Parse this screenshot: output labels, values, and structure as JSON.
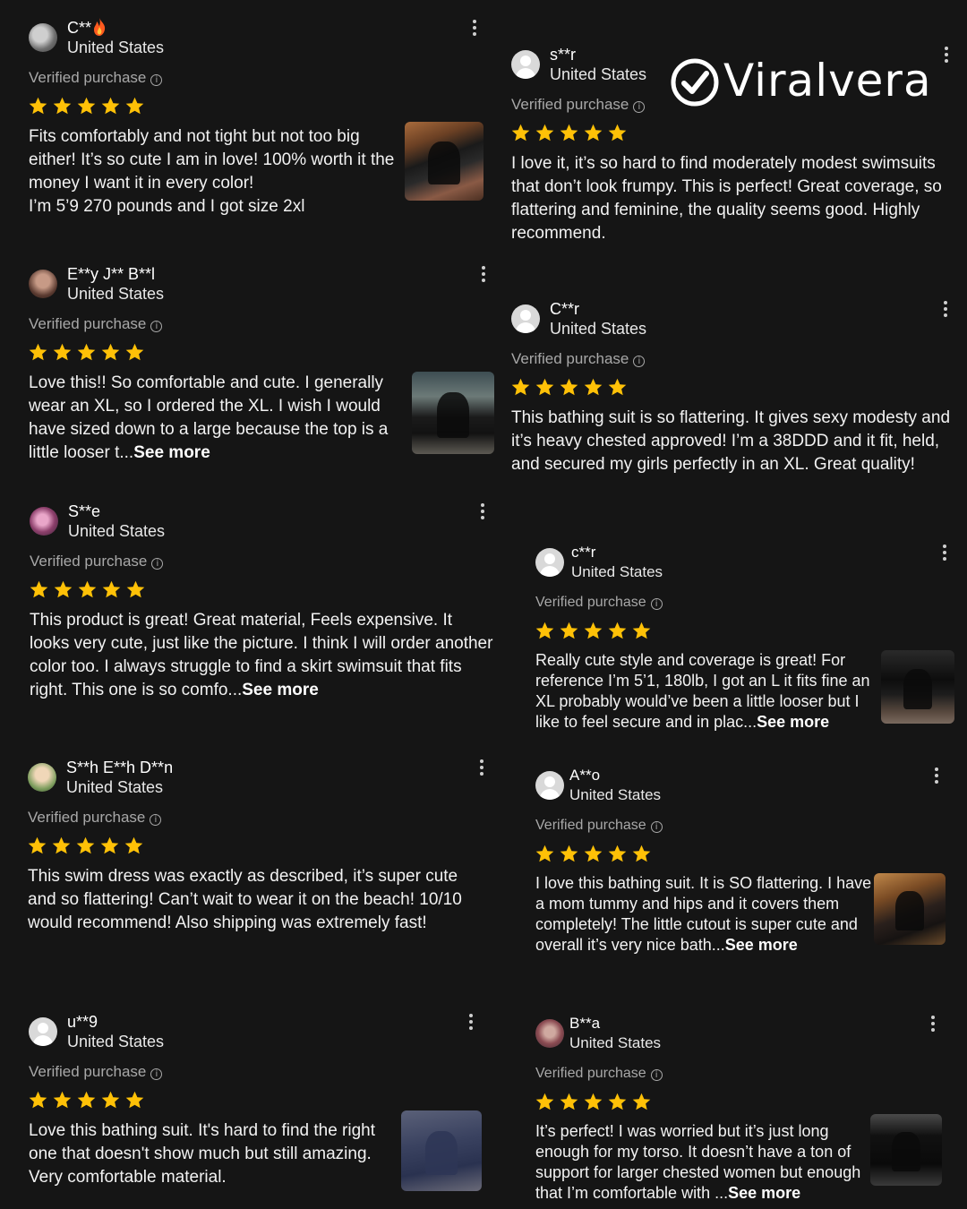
{
  "brand": {
    "name": "Viralvera",
    "icon": "check-circle-icon"
  },
  "verified_label": "Verified purchase",
  "info_icon_glyph": "i",
  "see_more_label": "See more",
  "rating_max": 5,
  "star_color": "#FFC107",
  "reviews": [
    {
      "user": "C**",
      "badge": "fire-emoji",
      "country": "United States",
      "rating": 5,
      "text": "Fits comfortably and not tight but not too big either! It’s so cute I am in love! 100% worth it the money I want it in every color!\nI’m 5’9 270 pounds and I got size 2xl"
    },
    {
      "user": "E**y J** B**l",
      "country": "United States",
      "rating": 5,
      "text": "Love this!! So comfortable and cute. I generally wear an XL, so I ordered the XL. I wish I would have sized down to a large because the top is a little looser t...",
      "truncated": true
    },
    {
      "user": "S**e",
      "country": "United States",
      "rating": 5,
      "text": "This product is great! Great material, Feels expensive. It looks very cute, just like the picture. I think I will order another color too. I always struggle to find a skirt swimsuit that fits right. This one is so comfo...",
      "truncated": true
    },
    {
      "user": "S**h E**h D**n",
      "country": "United States",
      "rating": 5,
      "text": "This swim dress was exactly as described, it’s super cute and so flattering! Can’t wait to wear it on the beach! 10/10 would recommend! Also shipping was extremely fast!"
    },
    {
      "user": "u**9",
      "country": "United States",
      "rating": 5,
      "text": "Love this bathing suit. It's hard to find the right one that doesn't show much but still amazing. Very comfortable material."
    },
    {
      "user": "s**r",
      "country": "United States",
      "rating": 5,
      "text": "I love it, it’s so hard to find moderately modest swimsuits that don’t look frumpy. This is perfect! Great coverage, so flattering and feminine, the quality seems good. Highly recommend."
    },
    {
      "user": "C**r",
      "country": "United States",
      "rating": 5,
      "text": "This bathing suit is so flattering. It gives sexy modesty and it’s heavy chested approved! I’m a 38DDD and it fit, held, and secured my girls perfectly in an XL. Great quality!"
    },
    {
      "user": "c**r",
      "country": "United States",
      "rating": 5,
      "text": "Really cute style and coverage is great! For reference I’m 5’1, 180lb, I got an L it fits fine an XL probably would’ve been a little looser but I like to feel secure and in plac...",
      "truncated": true
    },
    {
      "user": "A**o",
      "country": "United States",
      "rating": 5,
      "text": "I love this bathing suit. It is SO flattering. I have a mom tummy and hips and it covers them completely! The little cutout is super cute and overall it’s very nice bath...",
      "truncated": true
    },
    {
      "user": "B**a",
      "country": "United States",
      "rating": 5,
      "text": "It’s perfect! I was worried but it’s just long enough for my torso. It doesn’t have a ton of support for larger chested women but enough that I’m comfortable with ...",
      "truncated": true
    }
  ]
}
